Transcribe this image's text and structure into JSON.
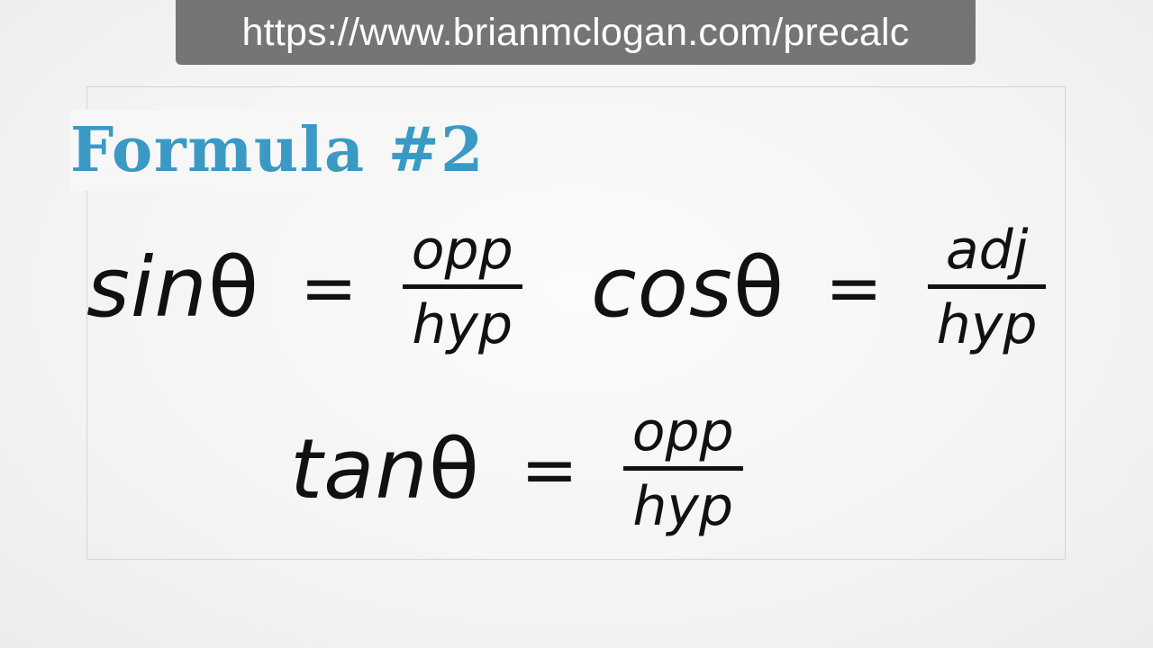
{
  "banner": {
    "url": "https://www.brianmclogan.com/precalc"
  },
  "slide": {
    "title": "Formula #2",
    "theta_symbol": "θ",
    "equals_symbol": "=",
    "equations": {
      "sin": {
        "function": "sin",
        "numerator": "opp",
        "denominator": "hyp"
      },
      "cos": {
        "function": "cos",
        "numerator": "adj",
        "denominator": "hyp"
      },
      "tan": {
        "function": "tan",
        "numerator": "opp",
        "denominator": "hyp"
      }
    }
  },
  "colors": {
    "title": "#3a9ac4",
    "banner_background": "#757575",
    "banner_text": "#ffffff",
    "equation_text": "#111111"
  }
}
